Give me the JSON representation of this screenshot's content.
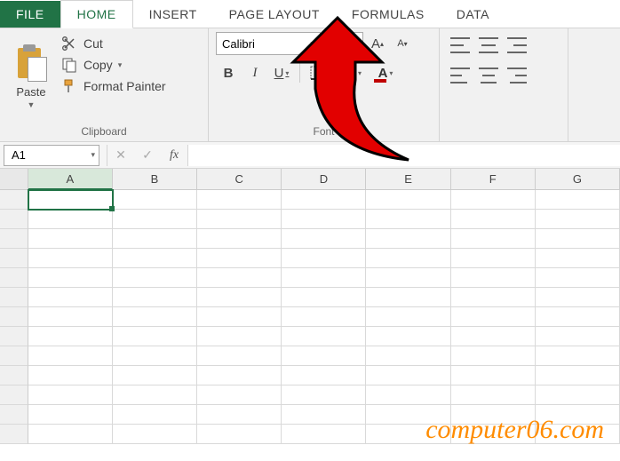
{
  "tabs": {
    "file": "FILE",
    "home": "HOME",
    "insert": "INSERT",
    "page_layout": "PAGE LAYOUT",
    "formulas": "FORMULAS",
    "data": "DATA"
  },
  "clipboard": {
    "paste": "Paste",
    "cut": "Cut",
    "copy": "Copy",
    "format_painter": "Format Painter",
    "group_label": "Clipboard"
  },
  "font": {
    "name": "Calibri",
    "size": "",
    "bold": "B",
    "italic": "I",
    "underline": "U",
    "grow_a": "A",
    "shrink_a": "A",
    "font_color_letter": "A",
    "group_label": "Font",
    "accent_color": "#c00000",
    "fill_color": "#ffff00"
  },
  "name_box": "A1",
  "fx_label": "fx",
  "columns": [
    "A",
    "B",
    "C",
    "D",
    "E",
    "F",
    "G"
  ],
  "active_cell": "A1",
  "watermark": "computer06.com"
}
